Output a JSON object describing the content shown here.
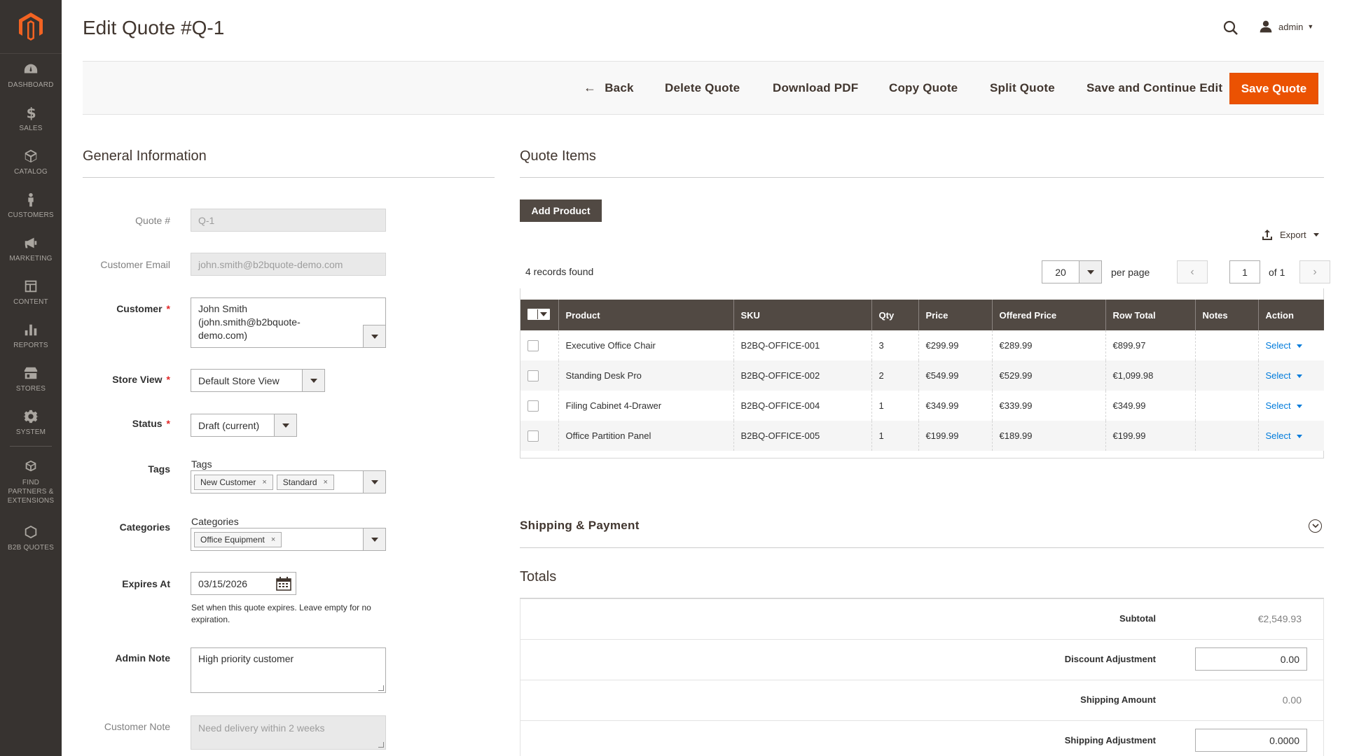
{
  "sidebar": {
    "items": [
      {
        "label": "Dashboard",
        "icon": "dashboard-icon"
      },
      {
        "label": "Sales",
        "icon": "dollar-icon"
      },
      {
        "label": "Catalog",
        "icon": "box-icon"
      },
      {
        "label": "Customers",
        "icon": "person-icon"
      },
      {
        "label": "Marketing",
        "icon": "megaphone-icon"
      },
      {
        "label": "Content",
        "icon": "layout-icon"
      },
      {
        "label": "Reports",
        "icon": "bar-chart-icon"
      },
      {
        "label": "Stores",
        "icon": "store-icon"
      },
      {
        "label": "System",
        "icon": "gear-icon"
      },
      {
        "label": "Find Partners & Extensions",
        "icon": "cubes-icon"
      },
      {
        "label": "B2B Quotes",
        "icon": "hexagon-icon"
      }
    ]
  },
  "header": {
    "title": "Edit Quote #Q-1",
    "user": "admin"
  },
  "actions": {
    "back": "Back",
    "delete": "Delete Quote",
    "download": "Download PDF",
    "copy": "Copy Quote",
    "split": "Split Quote",
    "save_continue": "Save and Continue Edit",
    "save": "Save Quote"
  },
  "general": {
    "title": "General Information",
    "quote_label": "Quote #",
    "quote_value": "Q-1",
    "email_label": "Customer Email",
    "email_value": "john.smith@b2bquote-demo.com",
    "customer_label": "Customer",
    "customer_line1": "John Smith",
    "customer_line2": "(john.smith@b2bquote-",
    "customer_line3": "demo.com)",
    "store_label": "Store View",
    "store_value": "Default Store View",
    "status_label": "Status",
    "status_value": "Draft (current)",
    "tags_label": "Tags",
    "tags_caption": "Tags",
    "tags": [
      "New Customer",
      "Standard"
    ],
    "categories_label": "Categories",
    "categories_caption": "Categories",
    "categories": [
      "Office Equipment"
    ],
    "expires_label": "Expires At",
    "expires_value": "03/15/2026",
    "expires_note": "Set when this quote expires. Leave empty for no expiration.",
    "admin_note_label": "Admin Note",
    "admin_note_value": "High priority customer",
    "customer_note_label": "Customer Note",
    "customer_note_value": "Need delivery within 2 weeks"
  },
  "items": {
    "title": "Quote Items",
    "add_product": "Add Product",
    "export": "Export",
    "records": "4 records found",
    "per_page": "20",
    "per_page_label": "per page",
    "page": "1",
    "of": "of 1",
    "columns": [
      "Product",
      "SKU",
      "Qty",
      "Price",
      "Offered Price",
      "Row Total",
      "Notes",
      "Action"
    ],
    "action_label": "Select",
    "rows": [
      {
        "product": "Executive Office Chair",
        "sku": "B2BQ-OFFICE-001",
        "qty": "3",
        "price": "€299.99",
        "offered": "€289.99",
        "total": "€899.97",
        "notes": ""
      },
      {
        "product": "Standing Desk Pro",
        "sku": "B2BQ-OFFICE-002",
        "qty": "2",
        "price": "€549.99",
        "offered": "€529.99",
        "total": "€1,099.98",
        "notes": ""
      },
      {
        "product": "Filing Cabinet 4-Drawer",
        "sku": "B2BQ-OFFICE-004",
        "qty": "1",
        "price": "€349.99",
        "offered": "€339.99",
        "total": "€349.99",
        "notes": ""
      },
      {
        "product": "Office Partition Panel",
        "sku": "B2BQ-OFFICE-005",
        "qty": "1",
        "price": "€199.99",
        "offered": "€189.99",
        "total": "€199.99",
        "notes": ""
      }
    ]
  },
  "shipping": {
    "title": "Shipping & Payment"
  },
  "totals": {
    "title": "Totals",
    "subtotal_label": "Subtotal",
    "subtotal_value": "€2,549.93",
    "discount_label": "Discount Adjustment",
    "discount_value": "0.00",
    "shipping_amount_label": "Shipping Amount",
    "shipping_amount_value": "0.00",
    "shipping_adj_label": "Shipping Adjustment",
    "shipping_adj_value": "0.0000"
  },
  "colors": {
    "accent": "#eb5202",
    "sidebar_bg": "#373330",
    "grid_header": "#514943",
    "link": "#007bdb"
  }
}
